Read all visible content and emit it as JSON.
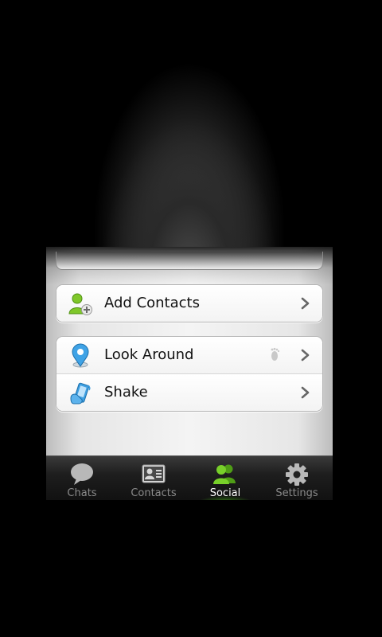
{
  "social_menu": {
    "groups": [
      {
        "items": [
          {
            "label": "Add Contacts",
            "icon": "add-contact-icon"
          }
        ]
      },
      {
        "items": [
          {
            "label": "Look Around",
            "icon": "location-pin-icon",
            "extra_icon": "footprint-icon"
          },
          {
            "label": "Shake",
            "icon": "shake-phone-icon"
          }
        ]
      }
    ]
  },
  "tabbar": {
    "tabs": [
      {
        "label": "Chats",
        "icon": "chat-bubble-icon",
        "active": false
      },
      {
        "label": "Contacts",
        "icon": "contact-card-icon",
        "active": false
      },
      {
        "label": "Social",
        "icon": "people-icon",
        "active": true
      },
      {
        "label": "Settings",
        "icon": "gear-icon",
        "active": false
      }
    ]
  },
  "colors": {
    "accent_green": "#5fbf1e",
    "active_tab_label": "#ffffff",
    "inactive_tab_label": "#8a8a8a",
    "row_text": "#111111"
  }
}
